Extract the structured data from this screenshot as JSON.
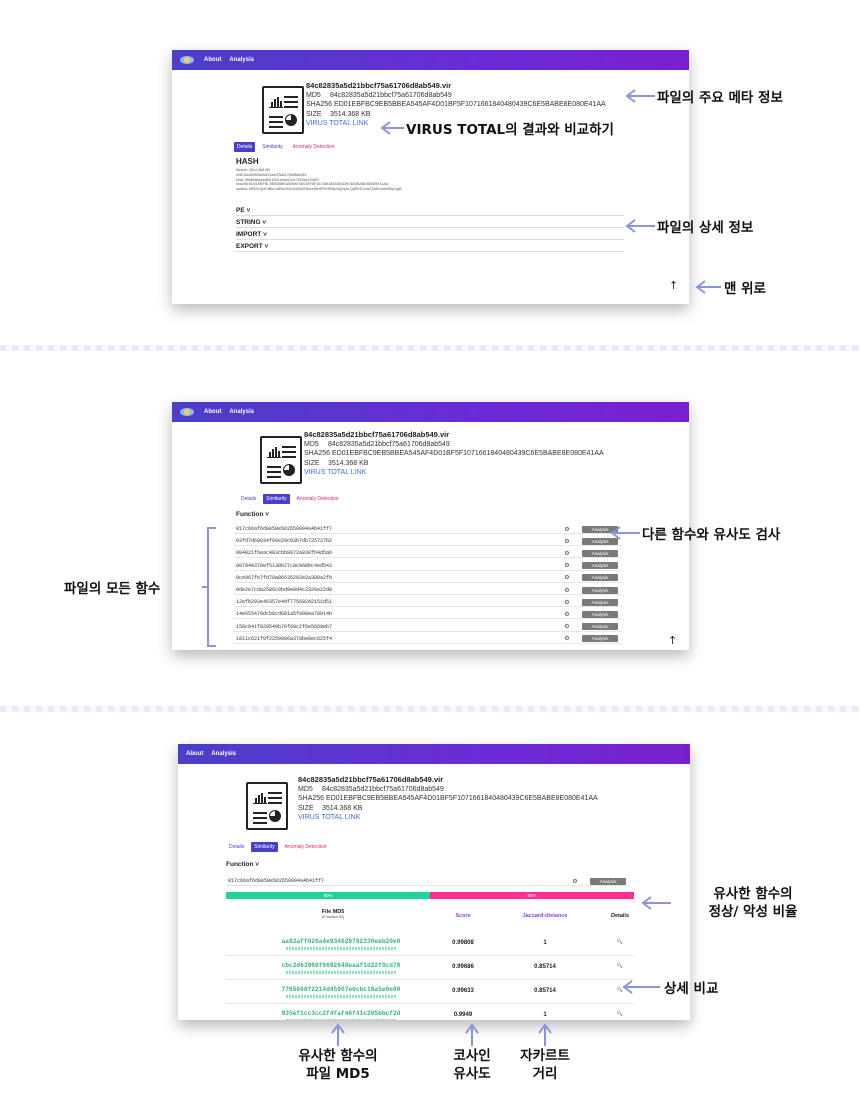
{
  "nav": {
    "about": "About",
    "analysis": "Analysis"
  },
  "file": {
    "name": "84c82835a5d21bbcf75a61706d8ab549.vir",
    "md5_label": "MD5",
    "md5": "84c82835a5d21bbcf75a61706d8ab549",
    "sha256_label": "SHA256",
    "sha256": "ED01EBFBC9EB5BBEA545AF4D01BF5F1071661840480439C6E5BABE8E080E41AA",
    "size_label": "SIZE",
    "size": "3514.368 KB",
    "vt_link": "VIRUS TOTAL LINK"
  },
  "tabs": {
    "details": "Details",
    "similarity": "Similarity",
    "anomaly": "Anomaly Detection"
  },
  "details": {
    "hash_title": "HASH",
    "hash_lines": [
      "filesize: 3514.368 KB",
      "md5     84c82835a5d21bbcf75a61706d8ab549",
      "sha1    5ff465a6aebdf0193d1a3ab2c2e7453a442d467",
      "sha256 ED01EBFBC9EB5BBEA545AF4D01BF5F1071661840480439C6E5BABE8E080E41AA",
      "ssdeep 98304:QuPoBhz1aRxcSUDh36SAEdnveWe9P593R8yXrijZq3s:QqPe1CxcsSZAEUadzR8yc4gB"
    ],
    "sections": [
      "PE",
      "STRING",
      "IMPORT",
      "EXPORT"
    ]
  },
  "function_label": "Function",
  "functions": [
    "017c66af6d8e50e562659994a4b41ff7",
    "03fd7d69034f69e20c03b7db725727b2",
    "084821f6eac483cbb8872a838fb4d5a6",
    "087940370ef5138b27c8c068bc4ed543",
    "0ce967fe7fd79a86635283e2a380a2fb",
    "0de2e7cda2586c0bd9e8d4c3326e22d8",
    "12efb293e46357e4df77560242151d51",
    "14e655479dcb8cd681a5fa98ea78914b",
    "158c641f829540b70f69c2f6e5669eb7",
    "1811c621f0f2259006a378be8ec625f4"
  ],
  "analysis_button": "Analysis",
  "selected_function": "017c66af6d8e50e562659994a4b41ff7",
  "ratio": {
    "normal_percent": 50,
    "malicious_percent": 50,
    "normal_label": "50%",
    "malicious_label": "50%"
  },
  "similarity_table": {
    "headers": {
      "md5": "File MD5",
      "md5_sub": "(Function ID)",
      "score": "Score",
      "jaccard": "Jaccard-distance",
      "details": "Details"
    },
    "rows": [
      {
        "md5": "aa82aff020a4e934628792330eeb20e0",
        "score": "0.99808",
        "jaccard": "1"
      },
      {
        "md5": "cbc2d63969f6692648eaaf1d22f0cd78",
        "score": "0.99686",
        "jaccard": "0.85714"
      },
      {
        "md5": "7765668f2214d45907e6cbc18a5e0e60",
        "score": "0.99633",
        "jaccard": "0.85714"
      },
      {
        "md5": "935ef1cc3cc2f4faf46f41c205bbcf2d",
        "score": "0.9949",
        "jaccard": "1"
      }
    ]
  },
  "annotations": {
    "meta": "파일의 주요 메타 정보",
    "vt": "VIRUS TOTAL의 결과와 비교하기",
    "detail": "파일의 상세 정보",
    "top": "맨 위로",
    "compare_func": "다른 함수와 유사도 검사",
    "all_funcs": "파일의 모든 함수",
    "ratio_line1": "유사한 함수의",
    "ratio_line2": "정상/ 악성 비율",
    "detail_compare": "상세 비교",
    "sim_md5_line1": "유사한 함수의",
    "sim_md5_line2": "파일 MD5",
    "cos_line1": "코사인",
    "cos_line2": "유사도",
    "jac_line1": "자카르트",
    "jac_line2": "거리"
  },
  "colors": {
    "nav_start": "#4b3fc8",
    "nav_end": "#7a1fd0",
    "normal": "#1fd39b",
    "malicious": "#ff2f8f",
    "link": "#3b6fd9"
  }
}
